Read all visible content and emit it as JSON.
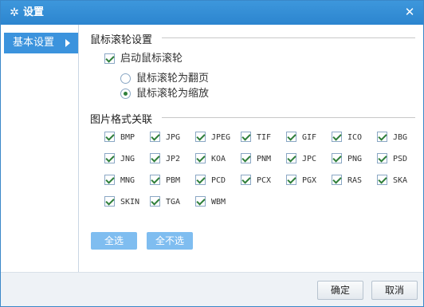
{
  "window": {
    "title": "设置"
  },
  "sidebar": {
    "items": [
      {
        "label": "基本设置"
      }
    ]
  },
  "scroll": {
    "section_title": "鼠标滚轮设置",
    "enable_label": "启动鼠标滚轮",
    "enable_checked": true,
    "options": [
      {
        "label": "鼠标滚轮为翻页",
        "checked": false
      },
      {
        "label": "鼠标滚轮为缩放",
        "checked": true
      }
    ]
  },
  "formats": {
    "section_title": "图片格式关联",
    "items": [
      "BMP",
      "JPG",
      "JPEG",
      "TIF",
      "GIF",
      "ICO",
      "JBG",
      "JNG",
      "JP2",
      "KOA",
      "PNM",
      "JPC",
      "PNG",
      "PSD",
      "MNG",
      "PBM",
      "PCD",
      "PCX",
      "PGX",
      "RAS",
      "SKA",
      "SKIN",
      "TGA",
      "WBM"
    ],
    "all_checked": true,
    "select_all": "全选",
    "select_none": "全不选"
  },
  "footer": {
    "ok": "确定",
    "cancel": "取消"
  },
  "colors": {
    "accent": "#3b93dd",
    "title_bar": "#2c85cf",
    "light_button": "#7fbdf0"
  }
}
